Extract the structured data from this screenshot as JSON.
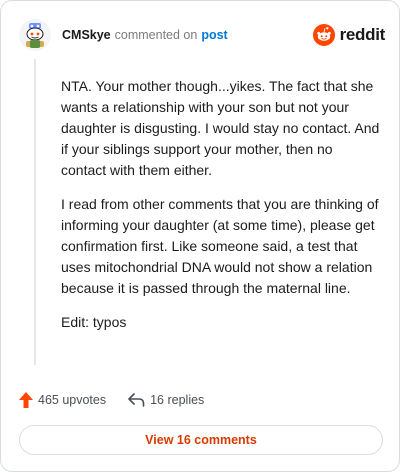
{
  "header": {
    "username": "CMSkye",
    "action": "commented on",
    "target": "post",
    "brand": "reddit"
  },
  "comment": {
    "paragraphs": [
      "NTA. Your mother though...yikes. The fact that she wants a relationship with your son but not your daughter is disgusting. I would stay no contact. And if your siblings support your mother, then no contact with them either.",
      "I read from other comments that you are thinking of informing your daughter (at some time), please get confirmation first. Like someone said, a test that uses mitochondrial DNA would not show a relation because it is passed through the maternal line.",
      "Edit: typos"
    ]
  },
  "stats": {
    "upvotes": "465 upvotes",
    "replies": "16 replies"
  },
  "footer": {
    "view_label": "View 16 comments"
  },
  "icons": {
    "avatar": "snoo-avatar-icon",
    "brand": "reddit-logo-icon",
    "upvote": "upvote-arrow-icon",
    "reply": "reply-arrow-icon"
  },
  "colors": {
    "brand_orange": "#ff4500",
    "link_blue": "#0079d3",
    "button_text": "#d93a00"
  }
}
